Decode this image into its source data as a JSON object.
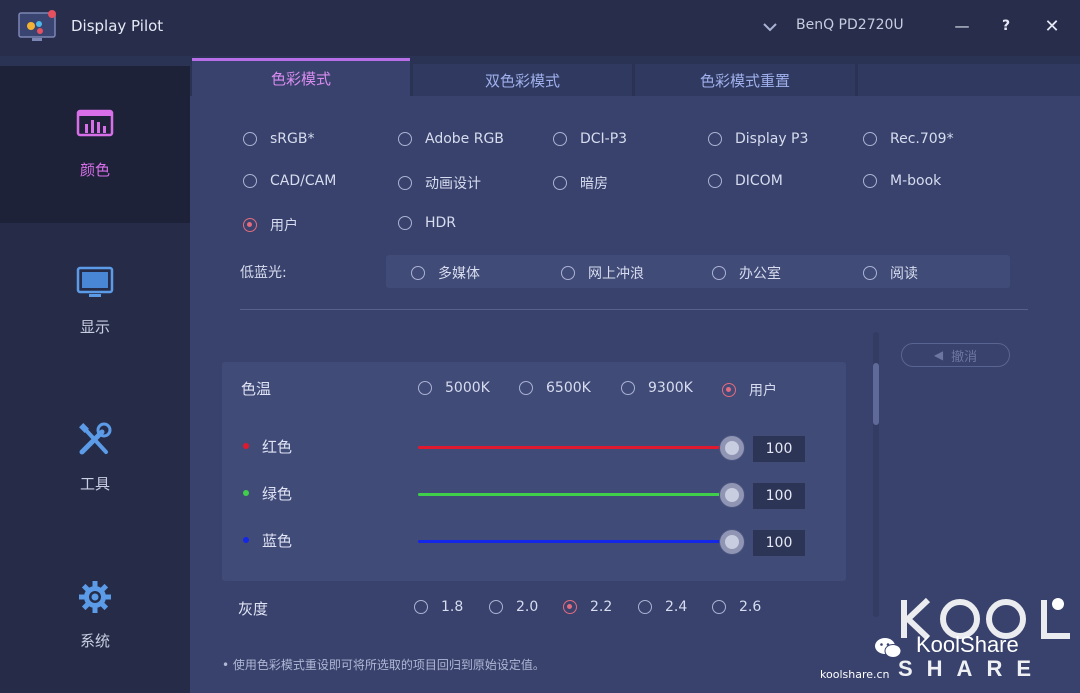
{
  "app": {
    "title": "Display Pilot",
    "monitor": "BenQ PD2720U",
    "window_controls": {
      "minimize": "—",
      "help": "?",
      "close": "✕"
    }
  },
  "sidebar": {
    "items": [
      {
        "label": "颜色",
        "icon": "color-bars-icon",
        "active": true
      },
      {
        "label": "显示",
        "icon": "monitor-icon",
        "active": false
      },
      {
        "label": "工具",
        "icon": "tools-icon",
        "active": false
      },
      {
        "label": "系统",
        "icon": "gear-icon",
        "active": false
      }
    ]
  },
  "tabs": [
    {
      "label": "色彩模式",
      "active": true
    },
    {
      "label": "双色彩模式",
      "active": false
    },
    {
      "label": "色彩模式重置",
      "active": false
    }
  ],
  "color_modes": [
    {
      "label": "sRGB*",
      "checked": false
    },
    {
      "label": "Adobe RGB",
      "checked": false
    },
    {
      "label": "DCI-P3",
      "checked": false
    },
    {
      "label": "Display P3",
      "checked": false
    },
    {
      "label": "Rec.709*",
      "checked": false
    },
    {
      "label": "CAD/CAM",
      "checked": false
    },
    {
      "label": "动画设计",
      "checked": false
    },
    {
      "label": "暗房",
      "checked": false
    },
    {
      "label": "DICOM",
      "checked": false
    },
    {
      "label": "M-book",
      "checked": false
    },
    {
      "label": "用户",
      "checked": true
    },
    {
      "label": "HDR",
      "checked": false
    }
  ],
  "low_blue_light": {
    "label": "低蓝光:",
    "options": [
      {
        "label": "多媒体",
        "checked": false
      },
      {
        "label": "网上冲浪",
        "checked": false
      },
      {
        "label": "办公室",
        "checked": false
      },
      {
        "label": "阅读",
        "checked": false
      }
    ]
  },
  "undo": {
    "label": "撤消",
    "icon": "undo-arrow-icon"
  },
  "color_temp": {
    "label": "色温",
    "options": [
      {
        "label": "5000K",
        "checked": false
      },
      {
        "label": "6500K",
        "checked": false
      },
      {
        "label": "9300K",
        "checked": false
      },
      {
        "label": "用户",
        "checked": true
      }
    ],
    "channels": [
      {
        "label": "红色",
        "value": "100",
        "level": 1.0,
        "color": "#e0192e"
      },
      {
        "label": "绿色",
        "value": "100",
        "level": 1.0,
        "color": "#3fcf4a"
      },
      {
        "label": "蓝色",
        "value": "100",
        "level": 1.0,
        "color": "#1426e8"
      }
    ]
  },
  "gamma": {
    "label": "灰度",
    "options": [
      {
        "label": "1.8",
        "checked": false
      },
      {
        "label": "2.0",
        "checked": false
      },
      {
        "label": "2.2",
        "checked": true
      },
      {
        "label": "2.4",
        "checked": false
      },
      {
        "label": "2.6",
        "checked": false
      }
    ]
  },
  "note": "• 使用色彩模式重设即可将所选取的项目回归到原始设定值。",
  "watermark": {
    "brand": "KoolShare",
    "share": "SHARE",
    "site": "koolshare.cn",
    "partial_text": "色彩模式   用户"
  },
  "colors": {
    "accent": "#d86fe8",
    "radio_checked": "#e46b7e",
    "panel": "#38426c"
  }
}
